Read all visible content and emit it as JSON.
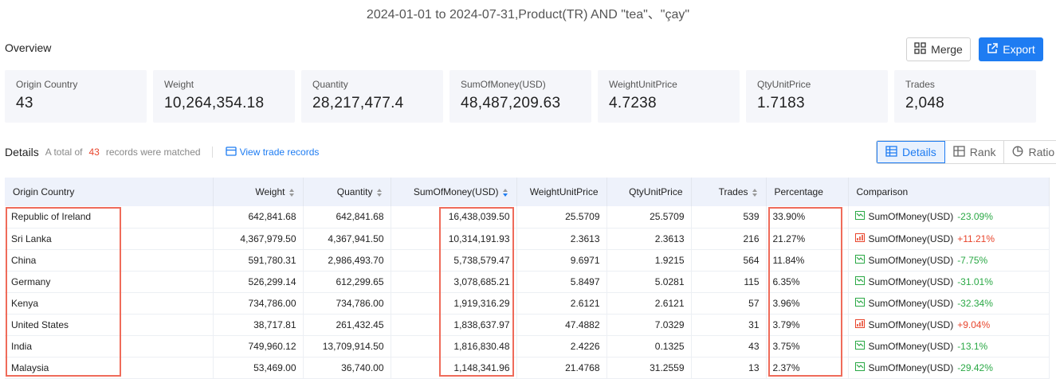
{
  "query_title": "2024-01-01 to 2024-07-31,Product(TR) AND \"tea\"、\"çay\"",
  "overview": {
    "title": "Overview",
    "merge_label": "Merge",
    "export_label": "Export",
    "stats": [
      {
        "label": "Origin Country",
        "value": "43"
      },
      {
        "label": "Weight",
        "value": "10,264,354.18"
      },
      {
        "label": "Quantity",
        "value": "28,217,477.4"
      },
      {
        "label": "SumOfMoney(USD)",
        "value": "48,487,209.63"
      },
      {
        "label": "WeightUnitPrice",
        "value": "4.7238"
      },
      {
        "label": "QtyUnitPrice",
        "value": "1.7183"
      },
      {
        "label": "Trades",
        "value": "2,048"
      }
    ]
  },
  "details": {
    "title": "Details",
    "total_prefix": "A total of",
    "total_count": "43",
    "total_suffix": "records were matched",
    "view_link": "View trade records",
    "views": [
      "Details",
      "Rank",
      "Ratio"
    ]
  },
  "table": {
    "headers": [
      "Origin Country",
      "Weight",
      "Quantity",
      "SumOfMoney(USD)",
      "WeightUnitPrice",
      "QtyUnitPrice",
      "Trades",
      "Percentage",
      "Comparison"
    ],
    "rows": [
      {
        "country": "Republic of Ireland",
        "weight": "642,841.68",
        "quantity": "642,841.68",
        "money": "16,438,039.50",
        "wup": "25.5709",
        "qup": "25.5709",
        "trades": "539",
        "pct": "33.90%",
        "cmp_label": "SumOfMoney(USD)",
        "cmp_value": "-23.09%",
        "trend": "down"
      },
      {
        "country": "Sri Lanka",
        "weight": "4,367,979.50",
        "quantity": "4,367,941.50",
        "money": "10,314,191.93",
        "wup": "2.3613",
        "qup": "2.3613",
        "trades": "216",
        "pct": "21.27%",
        "cmp_label": "SumOfMoney(USD)",
        "cmp_value": "+11.21%",
        "trend": "up"
      },
      {
        "country": "China",
        "weight": "591,780.31",
        "quantity": "2,986,493.70",
        "money": "5,738,579.47",
        "wup": "9.6971",
        "qup": "1.9215",
        "trades": "564",
        "pct": "11.84%",
        "cmp_label": "SumOfMoney(USD)",
        "cmp_value": "-7.75%",
        "trend": "down"
      },
      {
        "country": "Germany",
        "weight": "526,299.14",
        "quantity": "612,299.65",
        "money": "3,078,685.21",
        "wup": "5.8497",
        "qup": "5.0281",
        "trades": "115",
        "pct": "6.35%",
        "cmp_label": "SumOfMoney(USD)",
        "cmp_value": "-31.01%",
        "trend": "down"
      },
      {
        "country": "Kenya",
        "weight": "734,786.00",
        "quantity": "734,786.00",
        "money": "1,919,316.29",
        "wup": "2.6121",
        "qup": "2.6121",
        "trades": "57",
        "pct": "3.96%",
        "cmp_label": "SumOfMoney(USD)",
        "cmp_value": "-32.34%",
        "trend": "down"
      },
      {
        "country": "United States",
        "weight": "38,717.81",
        "quantity": "261,432.45",
        "money": "1,838,637.97",
        "wup": "47.4882",
        "qup": "7.0329",
        "trades": "31",
        "pct": "3.79%",
        "cmp_label": "SumOfMoney(USD)",
        "cmp_value": "+9.04%",
        "trend": "up"
      },
      {
        "country": "India",
        "weight": "749,960.12",
        "quantity": "13,709,914.50",
        "money": "1,816,830.48",
        "wup": "2.4226",
        "qup": "0.1325",
        "trades": "43",
        "pct": "3.75%",
        "cmp_label": "SumOfMoney(USD)",
        "cmp_value": "-13.1%",
        "trend": "down"
      },
      {
        "country": "Malaysia",
        "weight": "53,469.00",
        "quantity": "36,740.00",
        "money": "1,148,341.96",
        "wup": "21.4768",
        "qup": "31.2559",
        "trades": "13",
        "pct": "2.37%",
        "cmp_label": "SumOfMoney(USD)",
        "cmp_value": "-29.42%",
        "trend": "down"
      }
    ]
  },
  "colors": {
    "accent": "#1e7cf2",
    "up": "#e8452c",
    "down": "#2aa845",
    "highlight": "#ef6b5a"
  }
}
